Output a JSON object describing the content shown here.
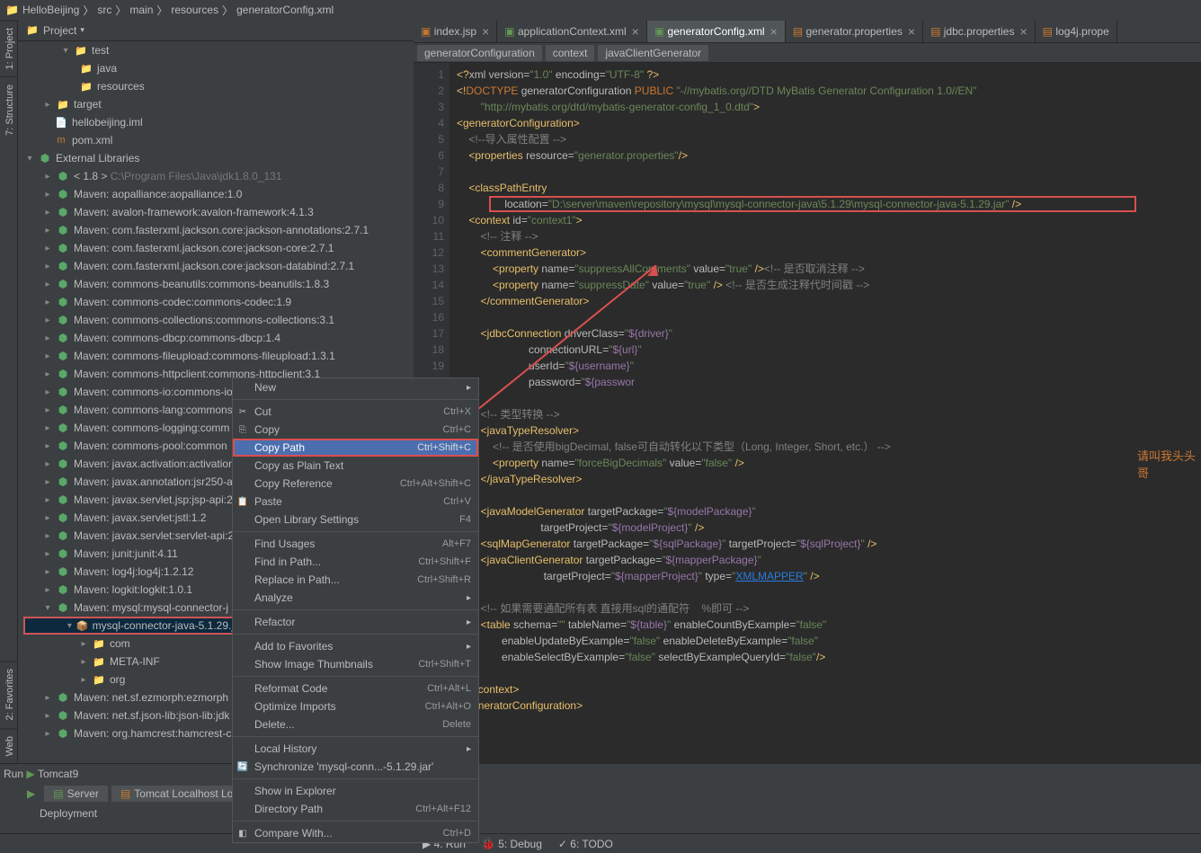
{
  "navbar": {
    "project": "HelloBeijing",
    "p1": "src",
    "p2": "main",
    "p3": "resources",
    "p4": "generatorConfig.xml"
  },
  "rail": {
    "project": "1: Project",
    "structure": "7: Structure",
    "favorites": "2: Favorites",
    "web": "Web"
  },
  "panel": {
    "title": "Project"
  },
  "tree": {
    "test": "test",
    "java": "java",
    "resources": "resources",
    "target": "target",
    "iml": "hellobeijing.iml",
    "pom": "pom.xml",
    "extlib": "External Libraries",
    "jdk": "< 1.8 >",
    "jdk_path": "C:\\Program Files\\Java\\jdk1.8.0_131",
    "libs": [
      "Maven: aopalliance:aopalliance:1.0",
      "Maven: avalon-framework:avalon-framework:4.1.3",
      "Maven: com.fasterxml.jackson.core:jackson-annotations:2.7.1",
      "Maven: com.fasterxml.jackson.core:jackson-core:2.7.1",
      "Maven: com.fasterxml.jackson.core:jackson-databind:2.7.1",
      "Maven: commons-beanutils:commons-beanutils:1.8.3",
      "Maven: commons-codec:commons-codec:1.9",
      "Maven: commons-collections:commons-collections:3.1",
      "Maven: commons-dbcp:commons-dbcp:1.4",
      "Maven: commons-fileupload:commons-fileupload:1.3.1",
      "Maven: commons-httpclient:commons-httpclient:3.1",
      "Maven: commons-io:commons-io",
      "Maven: commons-lang:commons",
      "Maven: commons-logging:comm",
      "Maven: commons-pool:common",
      "Maven: javax.activation:activation",
      "Maven: javax.annotation:jsr250-a",
      "Maven: javax.servlet.jsp:jsp-api:2.",
      "Maven: javax.servlet:jstl:1.2",
      "Maven: javax.servlet:servlet-api:2",
      "Maven: junit:junit:4.11",
      "Maven: log4j:log4j:1.2.12",
      "Maven: logkit:logkit:1.0.1",
      "Maven: mysql:mysql-connector-j"
    ],
    "mysql_jar": "mysql-connector-java-5.1.29.j",
    "com": "com",
    "meta": "META-INF",
    "org": "org",
    "libs2": [
      "Maven: net.sf.ezmorph:ezmorph",
      "Maven: net.sf.json-lib:json-lib:jdk",
      "Maven: org.hamcrest:hamcrest-c"
    ]
  },
  "tabs": [
    {
      "label": "index.jsp"
    },
    {
      "label": "applicationContext.xml"
    },
    {
      "label": "generatorConfig.xml"
    },
    {
      "label": "generator.properties"
    },
    {
      "label": "jdbc.properties"
    },
    {
      "label": "log4j.prope"
    }
  ],
  "breadcrumb": {
    "a": "generatorConfiguration",
    "b": "context",
    "c": "javaClientGenerator"
  },
  "code": {
    "l1": "<?xml version=\"1.0\" encoding=\"UTF-8\" ?>",
    "l2a": "<!DOCTYPE generatorConfiguration PUBLIC",
    "l2b": "\"-//mybatis.org//DTD MyBatis Generator Configuration 1.0//EN\"",
    "l3": "\"http://mybatis.org/dtd/mybatis-generator-config_1_0.dtd\">",
    "l4": "<generatorConfiguration>",
    "l5": "<!--导入属性配置 -->",
    "l6": "<properties resource=\"generator.properties\"/>",
    "l8": "<classPathEntry",
    "l9": "location=\"D:\\server\\maven\\repository\\mysql\\mysql-connector-java\\5.1.29\\mysql-connector-java-5.1.29.jar\" />",
    "l10": "<context id=\"context1\">",
    "l11": "<!-- 注释 -->",
    "l12": "<commentGenerator>",
    "l13a": "<property name=\"suppressAllComments\" value=\"true\" />",
    "l13b": "<!-- 是否取消注释 -->",
    "l14a": "<property name=\"suppressDate\" value=\"true\" />",
    "l14b": "<!-- 是否生成注释代时间戳 -->",
    "l15": "</commentGenerator>",
    "l17a": "<jdbcConnection driverClass=",
    "l17b": "\"${driver}\"",
    "l18a": "connectionURL=",
    "l18b": "\"${url}\"",
    "l19a": "userId=",
    "l19b": "\"${username}\"",
    "l20a": "password=",
    "l20b": "\"${passwor",
    "l22": "<!-- 类型转换 -->",
    "l23": "<javaTypeResolver>",
    "l24": "<!-- 是否使用bigDecimal, false可自动转化以下类型（Long, Integer, Short, etc.） -->",
    "l25": "<property name=\"forceBigDecimals\" value=\"false\" />",
    "l26": "</javaTypeResolver>",
    "l28a": "<javaModelGenerator targetPackage=",
    "l28b": "\"${modelPackage}\"",
    "l29a": "targetProject=",
    "l29b": "\"${modelProject}\"",
    "l29c": " />",
    "l30a": "<sqlMapGenerator targetPackage=",
    "l30b": "\"${sqlPackage}\"",
    "l30c": " targetProject=",
    "l30d": "\"${sqlProject}\"",
    "l30e": " />",
    "l31a": "<javaClientGenerator targetPackage=",
    "l31b": "\"${mapperPackage}\"",
    "l32a": "targetProject=",
    "l32b": "\"${mapperProject}\"",
    "l32c": " type=",
    "l32d": "\"XMLMAPPER\"",
    "l32e": " />",
    "l34": "<!-- 如果需要通配所有表 直接用sql的通配符    %即可 -->",
    "l35a": "<table schema=",
    "l35b": "\"\"",
    "l35c": " tableName=",
    "l35d": "\"${table}\"",
    "l35e": " enableCountByExample=",
    "l35f": "\"false\"",
    "l36a": "enableUpdateByExample=",
    "l36b": "\"false\"",
    "l36c": " enableDeleteByExample=",
    "l36d": "\"false\"",
    "l37a": "enableSelectByExample=",
    "l37b": "\"false\"",
    "l37c": " selectByExampleQueryId=",
    "l37d": "\"false\"",
    "l37e": "/>",
    "l39": "</context>",
    "l40": "</generatorConfiguration>"
  },
  "line_numbers": [
    "1",
    "2",
    "3",
    "4",
    "5",
    "6",
    "7",
    "8",
    "9",
    "10",
    "11",
    "12",
    "13",
    "14",
    "15",
    "16",
    "17",
    "18",
    "19"
  ],
  "watermark": "请叫我头头哥",
  "menu": {
    "new": "New",
    "cut": "Cut",
    "cut_s": "Ctrl+X",
    "copy": "Copy",
    "copy_s": "Ctrl+C",
    "copypath": "Copy Path",
    "copypath_s": "Ctrl+Shift+C",
    "copyplain": "Copy as Plain Text",
    "copyref": "Copy Reference",
    "copyref_s": "Ctrl+Alt+Shift+C",
    "paste": "Paste",
    "paste_s": "Ctrl+V",
    "openlibs": "Open Library Settings",
    "openlibs_s": "F4",
    "findusages": "Find Usages",
    "findusages_s": "Alt+F7",
    "findinpath": "Find in Path...",
    "findinpath_s": "Ctrl+Shift+F",
    "replaceinpath": "Replace in Path...",
    "replaceinpath_s": "Ctrl+Shift+R",
    "analyze": "Analyze",
    "refactor": "Refactor",
    "addtofav": "Add to Favorites",
    "showthumbs": "Show Image Thumbnails",
    "showthumbs_s": "Ctrl+Shift+T",
    "reformat": "Reformat Code",
    "reformat_s": "Ctrl+Alt+L",
    "optimports": "Optimize Imports",
    "optimports_s": "Ctrl+Alt+O",
    "delete": "Delete...",
    "delete_s": "Delete",
    "localhistory": "Local History",
    "sync": "Synchronize 'mysql-conn...-5.1.29.jar'",
    "showexplorer": "Show in Explorer",
    "dirpath": "Directory Path",
    "dirpath_s": "Ctrl+Alt+F12",
    "compare": "Compare With...",
    "compare_s": "Ctrl+D"
  },
  "bottom": {
    "run": "Run",
    "tomcat": "Tomcat9",
    "server": "Server",
    "log": "Tomcat Localhost Log",
    "deployment": "Deployment",
    "brun": "4: Run",
    "bdebug": "5: Debug",
    "btodo": "6: TODO"
  }
}
